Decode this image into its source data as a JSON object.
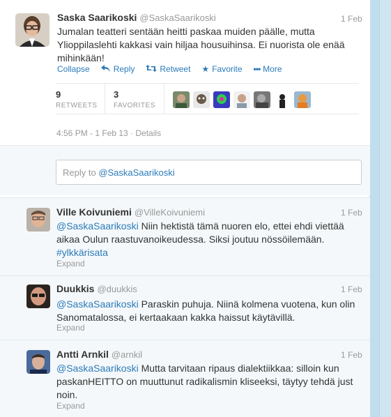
{
  "main_tweet": {
    "author_name": "Saska Saarikoski",
    "author_handle": "@SaskaSaarikoski",
    "date": "1 Feb",
    "text_line1": "Jumalan teatteri sentään heitti paskaa muiden päälle, mutta",
    "text_line2": "Ylioppilaslehti kakkasi vain hiljaa housuihinsa. Ei nuorista ole enää",
    "text_line3": "mihinkään!",
    "actions": {
      "collapse": "Collapse",
      "reply": "Reply",
      "retweet": "Retweet",
      "favorite": "Favorite",
      "more": "More"
    },
    "retweets_count": "9",
    "retweets_label": "RETWEETS",
    "favorites_count": "3",
    "favorites_label": "FAVORITES",
    "timestamp": "4:56 PM - 1 Feb 13 · Details"
  },
  "reply_box": {
    "prefix": "Reply to ",
    "mention": "@SaskaSaarikoski"
  },
  "replies": [
    {
      "name": "Ville Koivuniemi",
      "handle": "@VilleKoivuniemi",
      "date": "1 Feb",
      "mention": "@SaskaSaarikoski",
      "text_a": " Niin hektistä tämä nuoren elo, ettei ehdi viettää",
      "text_b": "aikaa Oulun raastuvanoikeudessa. Siksi joutuu nössöilemään.",
      "hashtag": "#ylkkärisata",
      "expand": "Expand"
    },
    {
      "name": "Duukkis",
      "handle": "@duukkis",
      "date": "1 Feb",
      "mention": "@SaskaSaarikoski",
      "text_a": " Paraskin puhuja. Niinä kolmena vuotena, kun olin",
      "text_b": "Sanomatalossa, ei kertaakaan kakka haissut käytävillä.",
      "expand": "Expand"
    },
    {
      "name": "Antti Arnkil",
      "handle": "@arnkil",
      "date": "1 Feb",
      "mention": "@SaskaSaarikoski",
      "text_a": " Mutta tarvitaan ripaus dialektiikkaa: silloin kun",
      "text_b": "paskanHEITTO on muuttunut radikalismin kliseeksi, täytyy tehdä just",
      "text_c": "noin.",
      "expand": "Expand"
    }
  ],
  "colors": {
    "link": "#2b7bb9",
    "background": "#c0deed",
    "muted": "#999999"
  }
}
